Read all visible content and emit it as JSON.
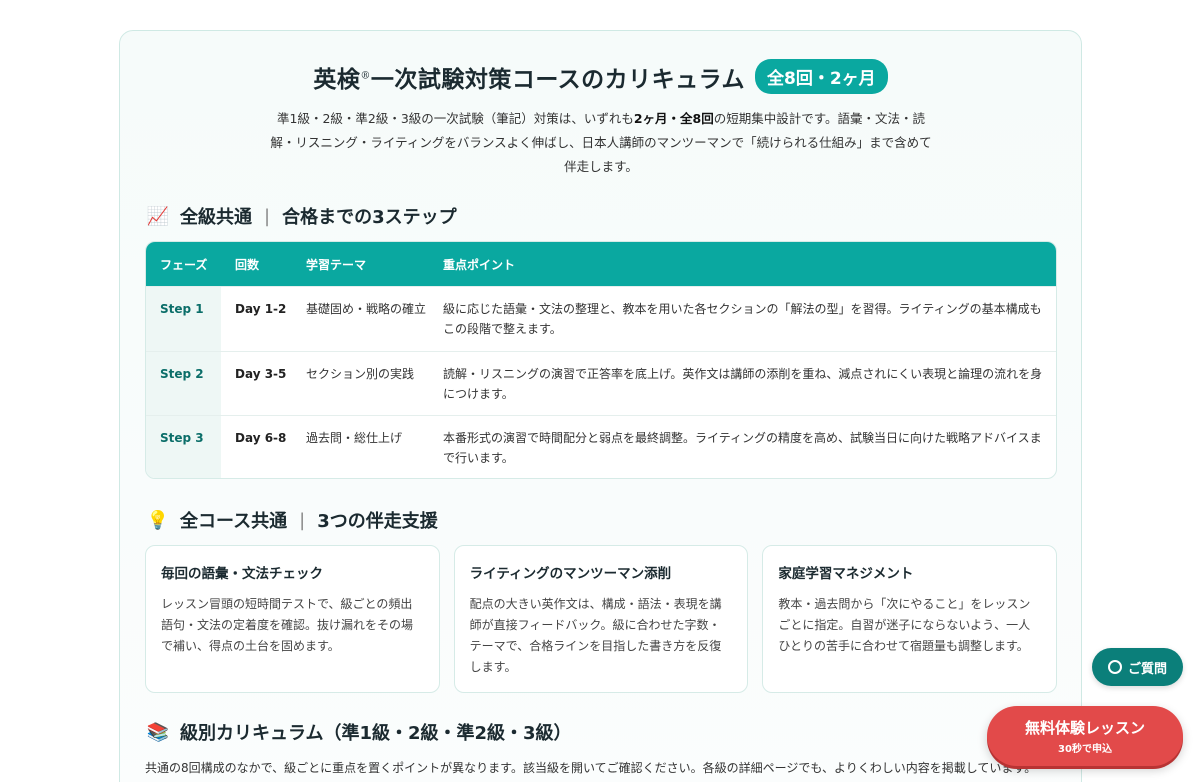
{
  "header": {
    "title_prefix": "英検",
    "title_mark": "®",
    "title_suffix": "一次試験対策コースのカリキュラム",
    "badge": "全8回・2ヶ月",
    "intro_a": "準1級・2級・準2級・3級の一次試験（筆記）対策は、いずれも",
    "intro_bold_a": "2ヶ月・全8回",
    "intro_b": "の短期集中設計です。語彙・文法・読解・リスニング・ライティングをバランスよく伸ばし、日本人講師のマンツーマンで「続けられる仕組み」まで含めて伴走します。"
  },
  "steps_section": {
    "icon": "chart-increasing-icon",
    "icon_glyph": "📈",
    "heading_a": "全級共通",
    "heading_sep": "|",
    "heading_b": "合格までの3ステップ",
    "columns": [
      "フェーズ",
      "回数",
      "学習テーマ",
      "重点ポイント"
    ],
    "rows": [
      {
        "phase": "Step 1",
        "days": "Day 1-2",
        "theme": "基礎固め・戦略の確立",
        "point": "級に応じた語彙・文法の整理と、教本を用いた各セクションの「解法の型」を習得。ライティングの基本構成もこの段階で整えます。"
      },
      {
        "phase": "Step 2",
        "days": "Day 3-5",
        "theme": "セクション別の実践",
        "point": "読解・リスニングの演習で正答率を底上げ。英作文は講師の添削を重ね、減点されにくい表現と論理の流れを身につけます。"
      },
      {
        "phase": "Step 3",
        "days": "Day 6-8",
        "theme": "過去問・総仕上げ",
        "point": "本番形式の演習で時間配分と弱点を最終調整。ライティングの精度を高め、試験当日に向けた戦略アドバイスまで行います。"
      }
    ]
  },
  "support_section": {
    "icon": "light-bulb-icon",
    "icon_glyph": "💡",
    "heading_a": "全コース共通",
    "heading_sep": "|",
    "heading_b": "3つの伴走支援",
    "cards": [
      {
        "title": "毎回の語彙・文法チェック",
        "body": "レッスン冒頭の短時間テストで、級ごとの頻出語句・文法の定着度を確認。抜け漏れをその場で補い、得点の土台を固めます。"
      },
      {
        "title": "ライティングのマンツーマン添削",
        "body": "配点の大きい英作文は、構成・語法・表現を講師が直接フィードバック。級に合わせた字数・テーマで、合格ラインを目指した書き方を反復します。"
      },
      {
        "title": "家庭学習マネジメント",
        "body": "教本・過去問から「次にやること」をレッスンごとに指定。自習が迷子にならないよう、一人ひとりの苦手に合わせて宿題量も調整します。"
      }
    ]
  },
  "grade_section": {
    "icon": "books-icon",
    "icon_glyph": "📚",
    "heading": "級別カリキュラム（準1級・2級・準2級・3級）",
    "text": "共通の8回構成のなかで、級ごとに重点を置くポイントが異なります。該当級を開いてご確認ください。各級の詳細ページでも、よりくわしい内容を掲載しています。"
  },
  "floating": {
    "faq_label": "ご質問",
    "trial_label": "無料体験レッスン",
    "trial_sub": "30秒で申込"
  },
  "colors": {
    "accent": "#0aa8a0",
    "accent_dark": "#0b7f7a",
    "cta": "#e24a4a"
  }
}
